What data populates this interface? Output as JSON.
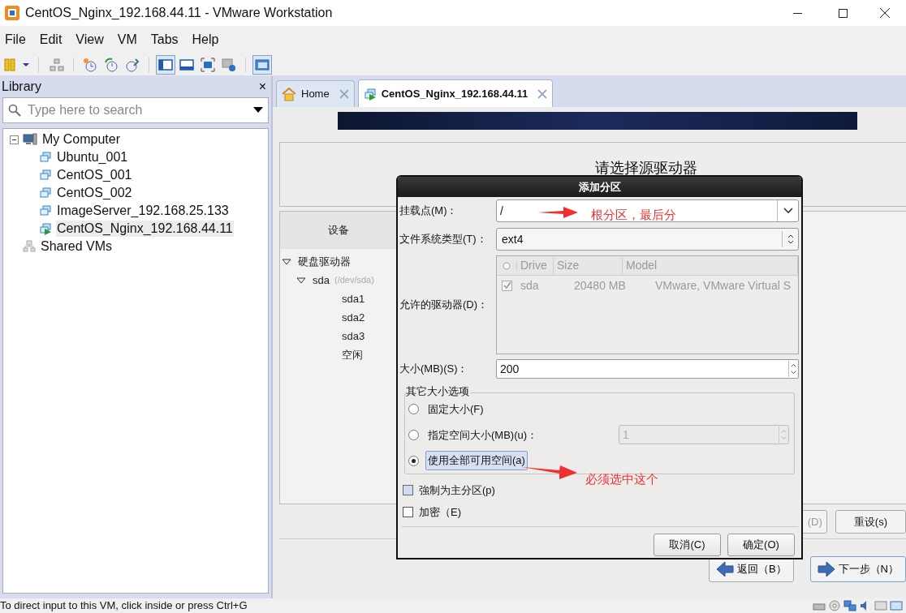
{
  "window": {
    "title": "CentOS_Nginx_192.168.44.11 - VMware Workstation"
  },
  "menu": [
    {
      "label": "File"
    },
    {
      "label": "Edit"
    },
    {
      "label": "View"
    },
    {
      "label": "VM"
    },
    {
      "label": "Tabs"
    },
    {
      "label": "Help"
    }
  ],
  "library": {
    "title": "Library",
    "close": "×",
    "search": {
      "placeholder": "Type here to search"
    },
    "tree": [
      {
        "label": "My Computer",
        "kind": "computer",
        "expanded": true,
        "selected": false,
        "children": [
          {
            "label": "Ubuntu_001",
            "kind": "vm",
            "running": false,
            "selected": false
          },
          {
            "label": "CentOS_001",
            "kind": "vm",
            "running": false,
            "selected": false
          },
          {
            "label": "CentOS_002",
            "kind": "vm",
            "running": false,
            "selected": false
          },
          {
            "label": "ImageServer_192.168.25.133",
            "kind": "vm",
            "running": false,
            "selected": false
          },
          {
            "label": "CentOS_Nginx_192.168.44.11",
            "kind": "vm",
            "running": true,
            "selected": true
          }
        ]
      },
      {
        "label": "Shared VMs",
        "kind": "shared",
        "selected": false
      }
    ]
  },
  "tabs": [
    {
      "label": "Home",
      "kind": "home",
      "selected": false
    },
    {
      "label": "CentOS_Nginx_192.168.44.11",
      "kind": "vm",
      "selected": true
    }
  ],
  "installer": {
    "heading": "请选择源驱动器",
    "device_column": "设备",
    "devices": [
      {
        "label": "硬盘驱动器",
        "expanded": true,
        "children": [
          {
            "label": "sda",
            "detail": "(/dev/sda)",
            "expanded": true,
            "children": [
              {
                "label": "sda1"
              },
              {
                "label": "sda2"
              },
              {
                "label": "sda3"
              },
              {
                "label": "空闲"
              }
            ]
          }
        ]
      }
    ],
    "buttons": [
      {
        "label": "(D)",
        "disabled": true
      },
      {
        "label": "重设(s)",
        "disabled": false
      }
    ],
    "nav": [
      {
        "label": "返回（B）",
        "kind": "back"
      },
      {
        "label": "下一步（N）",
        "kind": "next"
      }
    ]
  },
  "dialog": {
    "title": "添加分区",
    "mount_point": {
      "label": "挂载点(M)：",
      "value": "/"
    },
    "fs_type": {
      "label": "文件系统类型(T)：",
      "value": "ext4"
    },
    "drives": {
      "label": "允许的驱动器(D)：",
      "columns": [
        "Drive",
        "Size",
        "Model"
      ],
      "rows": [
        {
          "checked": true,
          "drive": "sda",
          "size": "20480 MB",
          "model": "VMware, VMware Virtual S"
        }
      ]
    },
    "size": {
      "label": "大小(MB)(S)：",
      "value": "200"
    },
    "other_sizes": {
      "legend": "其它大小选项",
      "options": [
        {
          "label": "固定大小(F)",
          "kind": "plain",
          "selected": false
        },
        {
          "label": "指定空间大小(MB)(u)：",
          "kind": "spin",
          "value": "1",
          "selected": false
        },
        {
          "label": "使用全部可用空间(a)",
          "kind": "plain",
          "selected": true
        }
      ]
    },
    "checks": [
      {
        "label": "強制为主分区(p)",
        "checked": false,
        "focused": true
      },
      {
        "label": "加密（E)",
        "checked": false,
        "focused": false
      }
    ],
    "buttons": [
      {
        "label": "取消(C)"
      },
      {
        "label": "确定(O)"
      }
    ]
  },
  "annotations": [
    {
      "text": "根分区，最后分"
    },
    {
      "text": "必须选中这个"
    }
  ],
  "status_bar": {
    "text": "To direct input to this VM, click inside or press Ctrl+G"
  }
}
